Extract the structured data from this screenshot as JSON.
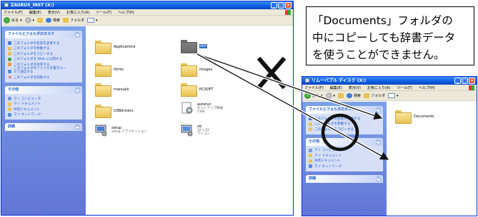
{
  "left_window": {
    "title": "ZAURUS_INST (X:)",
    "menu": [
      "ファイル(F)",
      "編集(E)",
      "表示(V)",
      "お気に入り(A)",
      "ツール(T)",
      "ヘルプ(H)"
    ],
    "toolbar": {
      "back": "戻る",
      "search": "検索",
      "folders": "フォルダ"
    },
    "tasks_title": "ファイルとフォルダのタスク",
    "tasks": [
      "このフォルダの名前を変更する",
      "このフォルダを移動する",
      "このフォルダをコピーする",
      "このフォルダを Web に公開する",
      "このフォルダを共有する",
      "このフォルダのファイルを電子メールで送信する",
      "このフォルダを削除する"
    ],
    "other_title": "その他",
    "other": [
      "マイ コンピュータ",
      "マイ ドキュメント",
      "共有ドキュメント",
      "マイ ネットワーク"
    ],
    "details_title": "詳細",
    "files": [
      {
        "name": "Applications",
        "sub": ""
      },
      {
        "name": "dict",
        "sub": ""
      },
      {
        "name": "htmls",
        "sub": ""
      },
      {
        "name": "images",
        "sub": ""
      },
      {
        "name": "manuals",
        "sub": ""
      },
      {
        "name": "PCSOFT",
        "sub": ""
      },
      {
        "name": "USBdrivers",
        "sub": ""
      },
      {
        "name": "autorun",
        "sub": "セットアップ情報",
        "sub2": "1 KB"
      },
      {
        "name": "setup",
        "sub": "setup アプリケーション"
      },
      {
        "name": "slc",
        "sub": "32 x 32",
        "sub2": "アイコン"
      }
    ]
  },
  "right_window": {
    "title": "リムーバブル ディスク (X:)",
    "menu": [
      "ファイル(F)",
      "編集(E)",
      "表示(V)",
      "お気に入り(A)",
      "ツール(T)",
      "ヘルプ(H)"
    ],
    "toolbar": {
      "back": "戻る",
      "search": "検索",
      "folders": "フォルダ"
    },
    "tasks_title": "ファイルとフォルダのタスク",
    "tasks": [
      "このフォルダの名前を変更する",
      "このフォルダを移動する",
      "このフォルダをコピーする"
    ],
    "other_title": "その他",
    "other": [
      "マイ コンピュータ",
      "マイ ドキュメント",
      "共有ドキュメント",
      "マイ ネットワーク"
    ],
    "details_title": "詳細",
    "files": [
      {
        "name": "Documents"
      }
    ]
  },
  "callout": {
    "lines": [
      "「Documents」フォルダの",
      "中にコピーしても辞書データ",
      "を使うことができません。"
    ]
  },
  "colors": {
    "titlebar": "#0a5ce0",
    "taskpane": "#6f8ee0",
    "cross": "#111111"
  }
}
